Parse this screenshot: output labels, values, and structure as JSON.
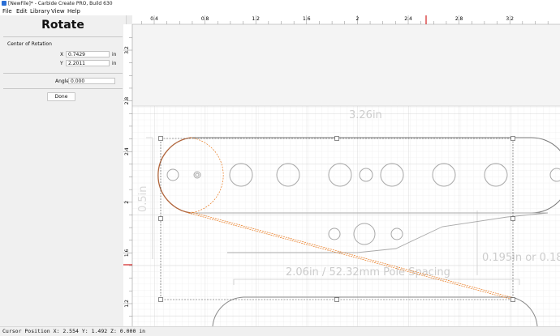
{
  "window": {
    "title": "[NewFile]* - Carbide Create PRO, Build 630"
  },
  "menu": {
    "file": "File",
    "edit": "Edit",
    "library": "Library",
    "view": "View",
    "help": "Help"
  },
  "panel": {
    "title": "Rotate",
    "center_label": "Center of Rotation",
    "x_label": "X",
    "x_value": "0.7429",
    "x_unit": "in",
    "y_label": "Y",
    "y_value": "2.2011",
    "y_unit": "in",
    "angle_label": "Angle",
    "angle_value": "0.000",
    "done_label": "Done"
  },
  "ruler": {
    "h_labels": [
      "0.4",
      "0.8",
      "1.2",
      "1.6",
      "2",
      "2.4",
      "2.8",
      "3.2"
    ],
    "v_labels": [
      "3.2",
      "2.8",
      "2.4",
      "2",
      "1.6",
      "1.2"
    ]
  },
  "drawing_text": {
    "dim_width": "3.26in",
    "dim_spacing": "2.06in / 52.32mm Pole Spacing",
    "dim_side": "0.195in or 0.18",
    "dim_left": "0.5in"
  },
  "status": {
    "text": "Cursor Position X: 2.554 Y: 1.492 Z: 0.000 in"
  },
  "colors": {
    "accent": "#d22020",
    "selection_orange": "#e8781c"
  }
}
